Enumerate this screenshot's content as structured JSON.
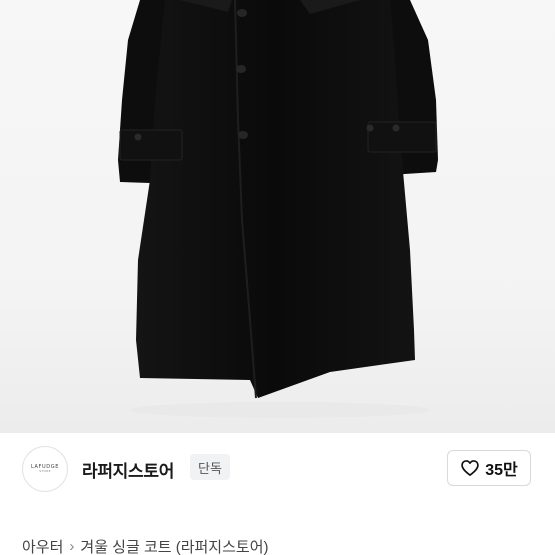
{
  "seller": {
    "logo_text": "LAFUDGE",
    "logo_subtext": "STORE",
    "name": "라퍼지스토어",
    "badge": "단독"
  },
  "like": {
    "icon": "heart-outline-icon",
    "count": "35만"
  },
  "breadcrumb": {
    "category": "아우터",
    "separator": "›",
    "product": "겨울 싱글 코트 (라퍼지스토어)"
  },
  "product_image": {
    "alt": "black long single coat"
  },
  "colors": {
    "coat": "#0b0b0b",
    "background": "#f5f5f5",
    "badge_bg": "#f1f2f4"
  }
}
